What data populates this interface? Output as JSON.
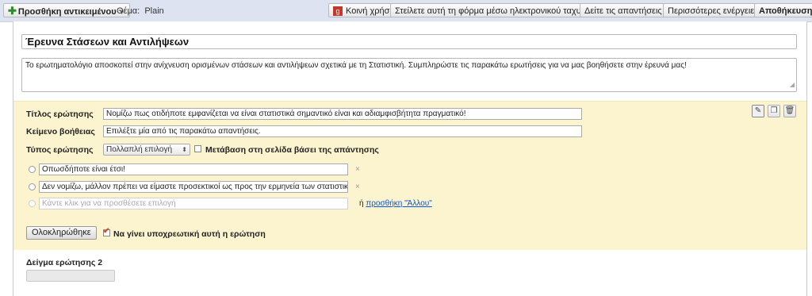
{
  "toolbar": {
    "add_item_label": "Προσθήκη αντικειμένου",
    "theme_label": "Θέμα:",
    "theme_value": "Plain",
    "share_label": "Κοινή χρήση",
    "email_form_label": "Στείλετε αυτή τη φόρμα μέσω ηλεκτρονικού ταχυδρομείου",
    "see_responses_label": "Δείτε τις απαντήσεις",
    "more_actions_label": "Περισσότερες ενέργειες",
    "save_label": "Αποθήκευση"
  },
  "form": {
    "title": "Έρευνα Στάσεων και Αντιλήψεων",
    "description": "Το ερωτηματολόγιο αποσκοπεί στην ανίχνευση ορισμένων στάσεων και αντιλήψεων σχετικά με τη Στατιστική. Συμπληρώστε τις παρακάτω ερωτήσεις για να μας βοηθήσετε στην έρευνά μας!"
  },
  "question": {
    "title_label": "Τίτλος ερώτησης",
    "title_value": "Νομίζω πως οτιδήποτε εμφανίζεται να είναι στατιστικά σημαντικό είναι και αδιαμφισβήτητα πραγματικό!",
    "help_label": "Κείμενο βοήθειας",
    "help_value": "Επιλέξτε μία από τις παρακάτω απαντήσεις.",
    "type_label": "Τύπος ερώτησης",
    "type_value": "Πολλαπλή επιλογή",
    "page_nav_label": "Μετάβαση στη σελίδα βάσει της απάντησης",
    "options": [
      "Οπωσδήποτε είναι έτσι!",
      "Δεν νομίζω, μάλλον πρέπει να είμαστε προσεκτικοί ως προς την ερμηνεία των στατιστικών αποτελε"
    ],
    "add_option_placeholder": "Κάντε κλικ για να προσθέσετε επιλογή",
    "or_label": "ή",
    "add_other_label": "προσθήκη \"Άλλου\"",
    "remove_icon": "×",
    "done_label": "Ολοκληρώθηκε",
    "required_label": "Να γίνει υποχρεωτική αυτή η ερώτηση"
  },
  "sample_question": {
    "label": "Δείγμα ερώτησης 2"
  },
  "icons": {
    "edit": "pencil-icon",
    "duplicate": "duplicate-icon",
    "delete": "trash-icon"
  },
  "colors": {
    "toolbar_bg": "#dde3f1",
    "editor_bg": "#fcf4cf",
    "link": "#1155cc"
  }
}
